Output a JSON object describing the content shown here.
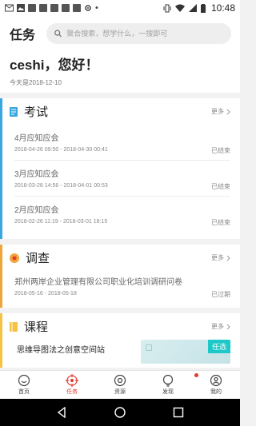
{
  "status_bar": {
    "time": "10:48"
  },
  "header": {
    "title": "任务",
    "search_placeholder": "聚合搜索，想学什么，一搜即可"
  },
  "greeting": {
    "hello": "ceshi，您好！",
    "date": "今天是2018-12-10"
  },
  "colors": {
    "accent_red": "#e5392c",
    "exam_blue": "#3aa7e0",
    "survey_orange": "#f0a53a",
    "course_yellow": "#f5c242",
    "tag_teal": "#1fc8c8"
  },
  "exam": {
    "title": "考试",
    "more": "更多",
    "icon": "exam-icon",
    "items": [
      {
        "name": "4月应知应会",
        "range": "2018-04-26 09:50 - 2018-04-30 00:41",
        "status": "已结束"
      },
      {
        "name": "3月应知应会",
        "range": "2018-03-28 14:56 - 2018-04-01 00:53",
        "status": "已结束"
      },
      {
        "name": "2月应知应会",
        "range": "2018-02-26 11:19 - 2018-03-01 18:15",
        "status": "已结束"
      }
    ]
  },
  "survey": {
    "title": "调查",
    "more": "更多",
    "icon": "survey-icon",
    "items": [
      {
        "name": "郑州两岸企业管理有限公司职业化培训调研问卷",
        "range": "2018-05-16 - 2018-05-18",
        "status": "已过期"
      }
    ]
  },
  "course": {
    "title": "课程",
    "more": "更多",
    "icon": "course-icon",
    "items": [
      {
        "name": "思维导图法之创意空间站",
        "tag": "任选"
      }
    ]
  },
  "bottom_nav": [
    {
      "label": "首页",
      "icon": "home-icon"
    },
    {
      "label": "任务",
      "icon": "task-icon"
    },
    {
      "label": "资源",
      "icon": "resource-icon"
    },
    {
      "label": "发现",
      "icon": "discover-icon"
    },
    {
      "label": "我的",
      "icon": "profile-icon"
    }
  ]
}
